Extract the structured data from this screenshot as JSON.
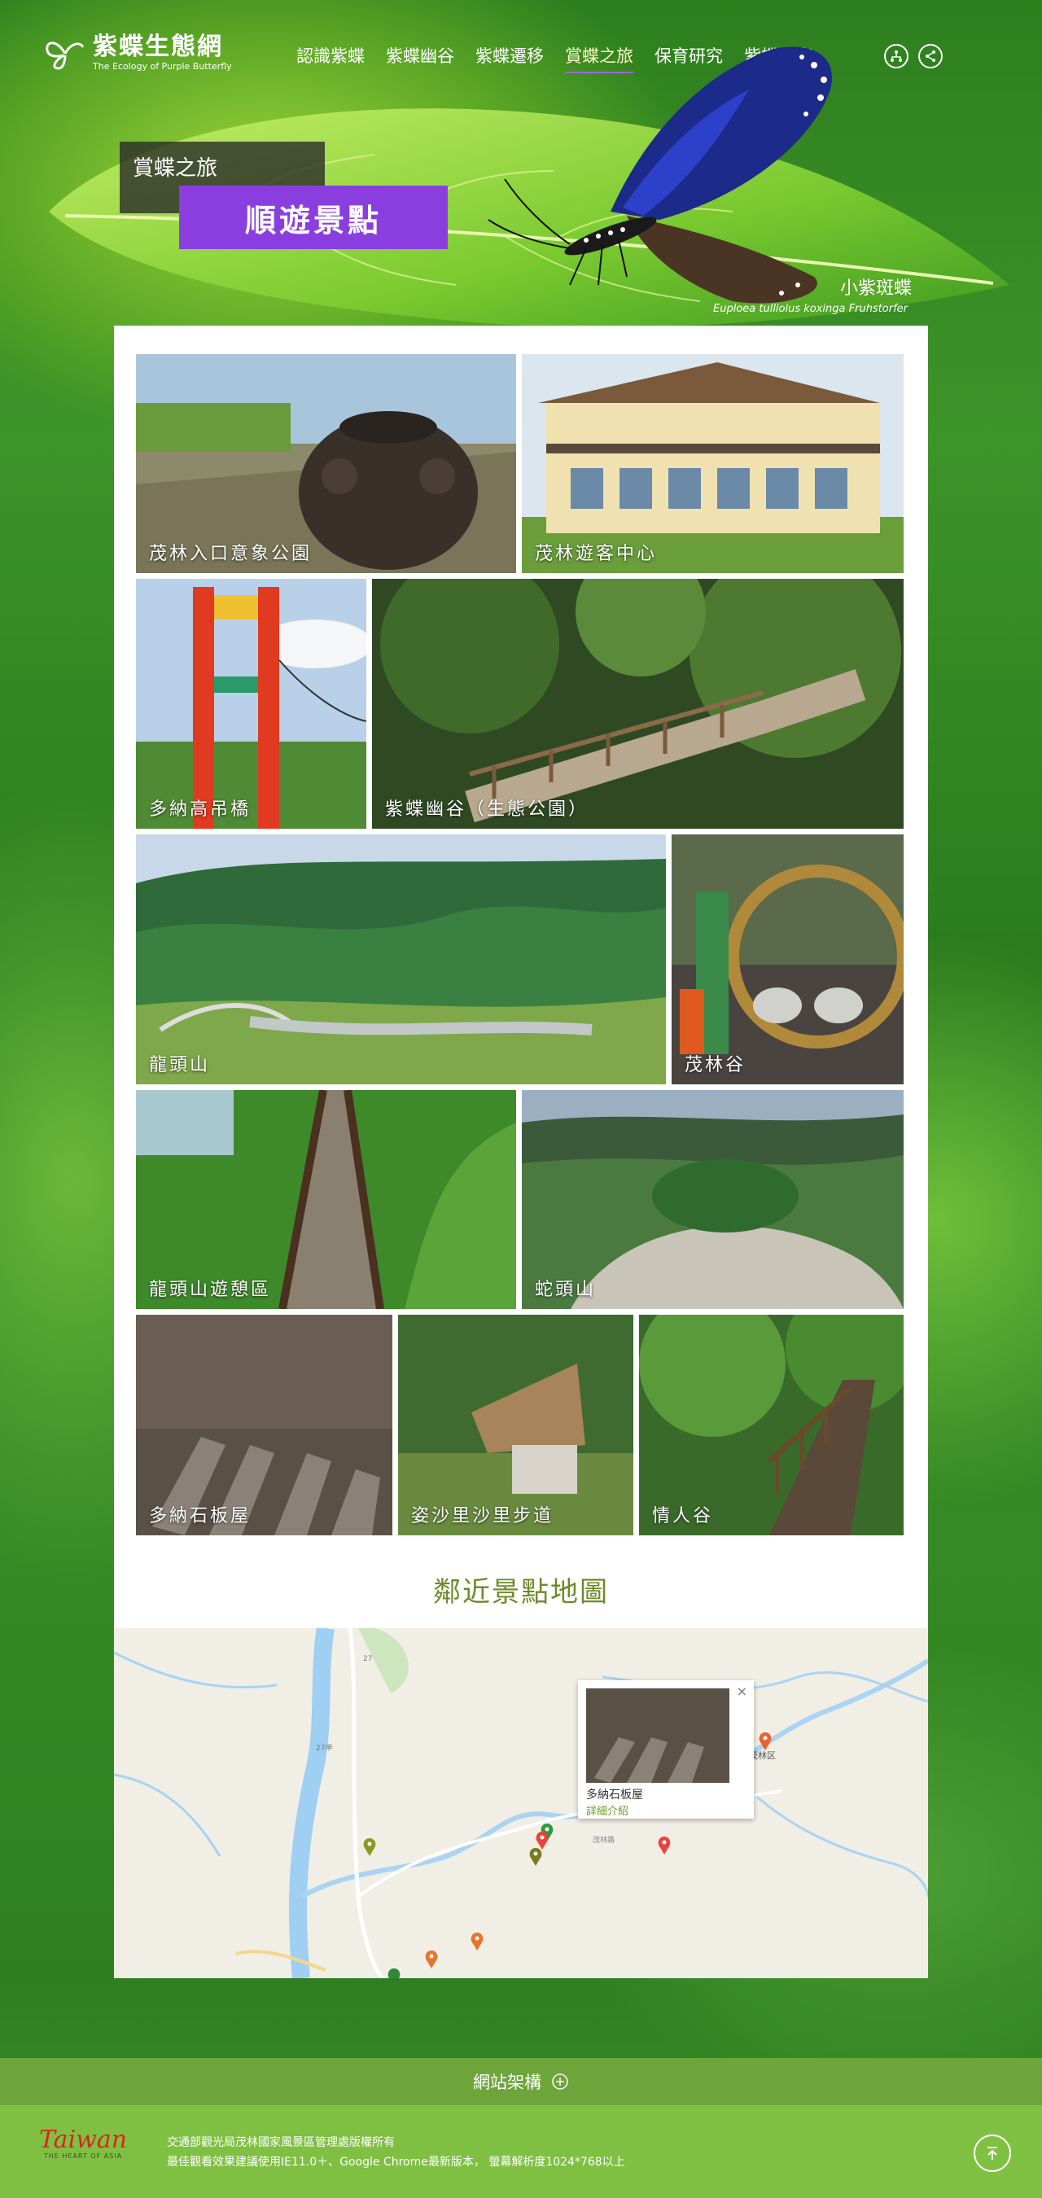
{
  "header": {
    "logo_title": "紫蝶生態網",
    "logo_subtitle": "The Ecology of Purple Butterfly",
    "nav": [
      {
        "label": "認識紫蝶"
      },
      {
        "label": "紫蝶幽谷"
      },
      {
        "label": "紫蝶遷移"
      },
      {
        "label": "賞蝶之旅"
      },
      {
        "label": "保育研究"
      },
      {
        "label": "紫蝶分享"
      }
    ],
    "icons": [
      "sitemap-icon",
      "share-icon"
    ]
  },
  "hero": {
    "section": "賞蝶之旅",
    "title": "順遊景點",
    "butterfly_name": "小紫斑蝶",
    "butterfly_latin": "Euploea tulliolus koxinga Fruhstorfer"
  },
  "spots": [
    {
      "label": "茂林入口意象公園"
    },
    {
      "label": "茂林遊客中心"
    },
    {
      "label": "多納高吊橋"
    },
    {
      "label": "紫蝶幽谷（生態公園）"
    },
    {
      "label": "龍頭山"
    },
    {
      "label": "茂林谷"
    },
    {
      "label": "龍頭山遊憩區"
    },
    {
      "label": "蛇頭山"
    },
    {
      "label": "多納石板屋"
    },
    {
      "label": "姿沙里沙里步道"
    },
    {
      "label": "情人谷"
    }
  ],
  "map": {
    "title": "鄰近景點地圖",
    "popup_name": "多納石板屋",
    "popup_link": "詳細介紹",
    "popup_close": "×",
    "label_village": "茂林区",
    "label_road": "茂林路",
    "label_hwy1": "27",
    "label_hwy2": "27甲"
  },
  "footer": {
    "sitemap": "網站架構",
    "brand": "Taiwan",
    "brand_sub": "THE HEART OF ASIA",
    "copyright": "交通部觀光局茂林國家風景區管理處版權所有",
    "browser_note": "最佳觀看效果建議使用IE11.0＋、Google Chrome最新版本， 螢幕解析度1024*768以上"
  },
  "colors": {
    "accent_purple": "#8a3ee0",
    "accent_green": "#6c8a28",
    "footer_bar": "#6ea53a",
    "footer": "#7fc043"
  }
}
